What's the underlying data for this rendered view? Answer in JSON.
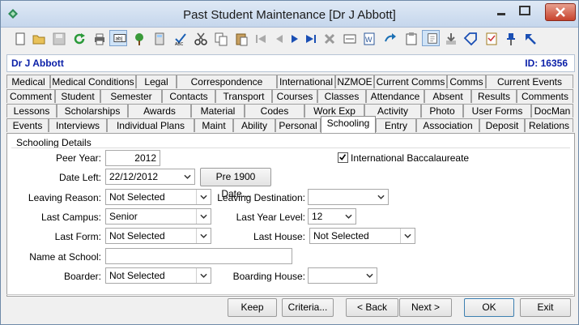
{
  "window": {
    "title": "Past Student Maintenance  [Dr J Abbott]"
  },
  "record": {
    "name": "Dr J Abbott",
    "id_label": "ID: 16356"
  },
  "toolbar_icons": [
    "new-icon",
    "open-icon",
    "save-icon",
    "refresh-icon",
    "print-icon",
    "field-icon",
    "tree-icon",
    "calculator-icon",
    "spellcheck-icon",
    "cut-icon",
    "copy-icon",
    "paste-icon",
    "first-record-icon",
    "previous-record-icon",
    "next-record-icon",
    "last-record-icon",
    "delete-icon",
    "card-icon",
    "word-icon",
    "forward-icon",
    "clipboard-icon",
    "notepad-icon",
    "download-icon",
    "tag-icon",
    "checklist-icon",
    "pin-icon",
    "up-left-arrow-icon"
  ],
  "tabs": {
    "row1": [
      "Medical",
      "Medical Conditions",
      "Legal",
      "Correspondence",
      "International",
      "NZMOE",
      "Current Comms",
      "Comms",
      "Current Events"
    ],
    "row2": [
      "Comment",
      "Student",
      "Semester",
      "Contacts",
      "Transport",
      "Courses",
      "Classes",
      "Attendance",
      "Absent",
      "Results",
      "Comments"
    ],
    "row3": [
      "Lessons",
      "Scholarships",
      "Awards",
      "Material",
      "Codes",
      "Work Exp",
      "Activity",
      "Photo",
      "User Forms",
      "DocMan"
    ],
    "row4": [
      "Events",
      "Interviews",
      "Individual Plans",
      "Maint",
      "Ability",
      "Personal",
      "Schooling",
      "Entry",
      "Association",
      "Deposit",
      "Relations"
    ]
  },
  "schooling": {
    "group_label": "Schooling Details",
    "peer_year_label": "Peer Year:",
    "peer_year": "2012",
    "date_left_label": "Date Left:",
    "date_left": "22/12/2012",
    "pre1900_label": "Pre 1900 Date...",
    "ib_label": "International Baccalaureate",
    "ib_checked": true,
    "leaving_reason_label": "Leaving Reason:",
    "leaving_reason": "Not Selected",
    "leaving_destination_label": "Leaving Destination:",
    "leaving_destination": "",
    "last_campus_label": "Last Campus:",
    "last_campus": "Senior",
    "last_year_level_label": "Last Year Level:",
    "last_year_level": "12",
    "last_form_label": "Last Form:",
    "last_form": "Not Selected",
    "last_house_label": "Last House:",
    "last_house": "Not Selected",
    "name_at_school_label": "Name at School:",
    "name_at_school": "",
    "boarder_label": "Boarder:",
    "boarder": "Not Selected",
    "boarding_house_label": "Boarding House:",
    "boarding_house": ""
  },
  "buttons": {
    "keep": "Keep",
    "criteria": "Criteria...",
    "back": "< Back",
    "next": "Next >",
    "ok": "OK",
    "exit": "Exit"
  }
}
